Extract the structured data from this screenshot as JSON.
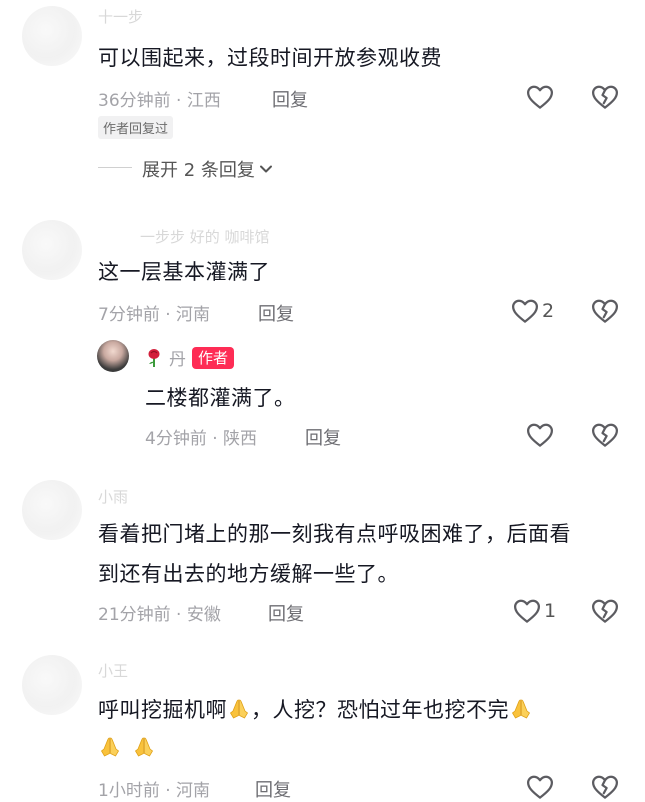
{
  "comments": [
    {
      "username": "十一步",
      "text": "可以围起来，过段时间开放参观收费",
      "time_location": "36分钟前 · 江西",
      "reply_label": "回复",
      "author_tag": "作者回复过",
      "expand_label": "展开 2 条回复"
    },
    {
      "username": "一步步 好的 咖啡馆",
      "text": "这一层基本灌满了",
      "time_location": "7分钟前 · 河南",
      "reply_label": "回复",
      "like_count": "2",
      "reply": {
        "username": "丹",
        "author_badge": "作者",
        "text": "二楼都灌满了。",
        "time_location": "4分钟前 · 陕西",
        "reply_label": "回复"
      }
    },
    {
      "username": "小雨",
      "text_line1": "看着把门堵上的那一刻我有点呼吸困难了，后面看",
      "text_line2": "到还有出去的地方缓解一些了。",
      "time_location": "21分钟前 · 安徽",
      "reply_label": "回复",
      "like_count": "1"
    },
    {
      "username": "小王",
      "text_part1": "呼叫挖掘机啊",
      "text_part2": "，人挖？恐怕过年也挖不完",
      "time_location": "1小时前 · 河南",
      "reply_label": "回复"
    }
  ],
  "icons": {
    "like": "heart-outline-icon",
    "dislike": "broken-heart-icon",
    "expand": "chevron-down-icon",
    "emoji": "folded-hands-emoji",
    "rose": "rose-emoji"
  },
  "colors": {
    "author_badge": "#fe2c55",
    "meta_text": "#a3a3a8"
  }
}
